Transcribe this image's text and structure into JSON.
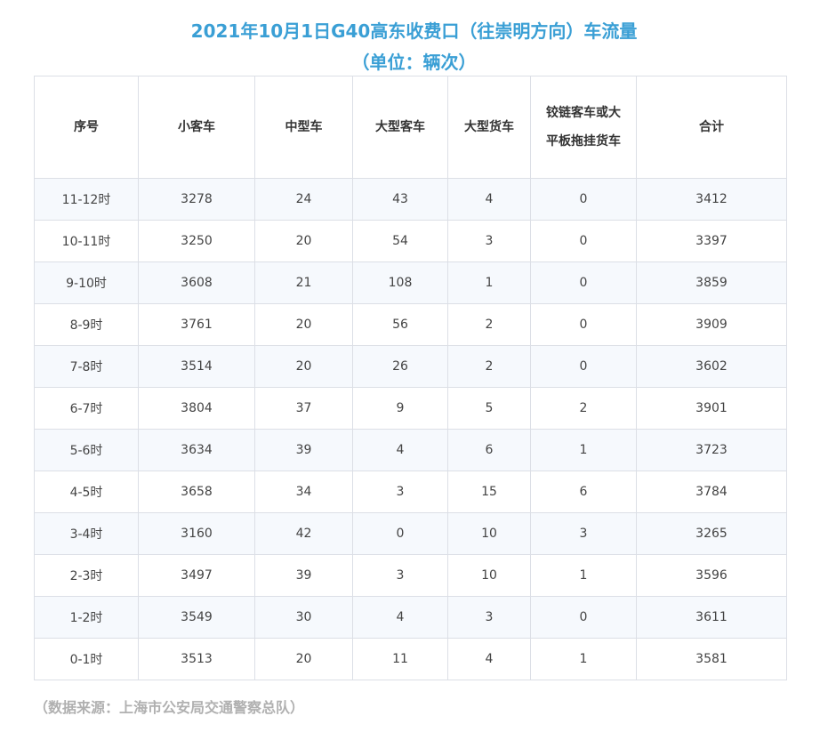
{
  "title": "2021年10月1日G40高东收费口（往崇明方向）车流量",
  "subtitle": "（单位：辆次）",
  "table": {
    "headers": [
      "序号",
      "小客车",
      "中型车",
      "大型客车",
      "大型货车",
      "铰链客车或大平板拖挂货车",
      "合计"
    ],
    "rows": [
      [
        "11-12时",
        "3278",
        "24",
        "43",
        "4",
        "0",
        "3412"
      ],
      [
        "10-11时",
        "3250",
        "20",
        "54",
        "3",
        "0",
        "3397"
      ],
      [
        "9-10时",
        "3608",
        "21",
        "108",
        "1",
        "0",
        "3859"
      ],
      [
        "8-9时",
        "3761",
        "20",
        "56",
        "2",
        "0",
        "3909"
      ],
      [
        "7-8时",
        "3514",
        "20",
        "26",
        "2",
        "0",
        "3602"
      ],
      [
        "6-7时",
        "3804",
        "37",
        "9",
        "5",
        "2",
        "3901"
      ],
      [
        "5-6时",
        "3634",
        "39",
        "4",
        "6",
        "1",
        "3723"
      ],
      [
        "4-5时",
        "3658",
        "34",
        "3",
        "15",
        "6",
        "3784"
      ],
      [
        "3-4时",
        "3160",
        "42",
        "0",
        "10",
        "3",
        "3265"
      ],
      [
        "2-3时",
        "3497",
        "39",
        "3",
        "10",
        "1",
        "3596"
      ],
      [
        "1-2时",
        "3549",
        "30",
        "4",
        "3",
        "0",
        "3611"
      ],
      [
        "0-1时",
        "3513",
        "20",
        "11",
        "4",
        "1",
        "3581"
      ]
    ]
  },
  "source": "（数据来源：上海市公安局交通警察总队）",
  "colors": {
    "title": "#3a9fd5",
    "border": "#dcdfe6",
    "row_alt": "#f6f9fd",
    "source_text": "#b0b0b0"
  }
}
